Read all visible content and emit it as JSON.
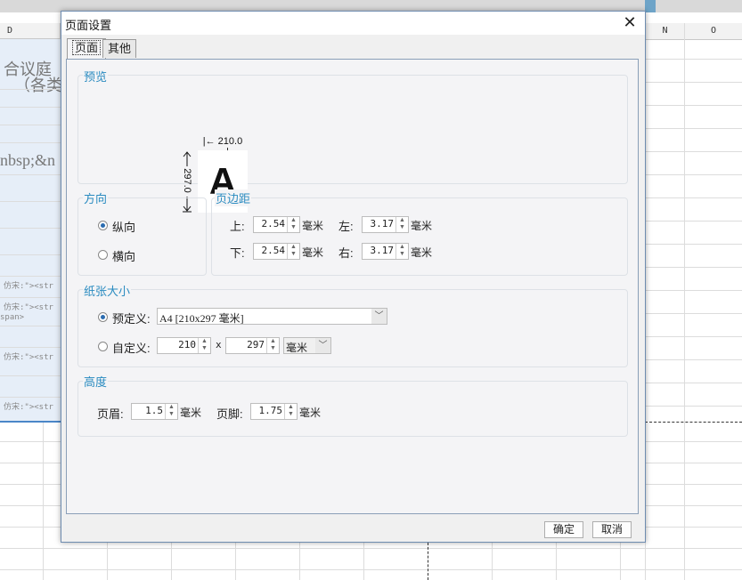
{
  "sheet": {
    "columns": [
      "D",
      "N",
      "O"
    ],
    "cell_texts": [
      "合议庭",
      "（各类",
      "nbsp;&n",
      "仿宋:\"><str",
      "仿宋:\"><str",
      "span>",
      "仿宋:\"><str",
      "仿宋:\"><str"
    ]
  },
  "dialog": {
    "title": "页面设置",
    "tabs": [
      "页面",
      "其他"
    ],
    "preview": {
      "legend": "预览",
      "width_label": "|← 210.0 →|",
      "height_label": "297.0",
      "sample_letter": "A"
    },
    "orientation": {
      "legend": "方向",
      "portrait": "纵向",
      "landscape": "横向",
      "selected": "portrait"
    },
    "margins": {
      "legend": "页边距",
      "top_label": "上:",
      "top_value": "2.54",
      "left_label": "左:",
      "left_value": "3.17",
      "bottom_label": "下:",
      "bottom_value": "2.54",
      "right_label": "右:",
      "right_value": "3.17",
      "unit": "毫米"
    },
    "paper_size": {
      "legend": "纸张大小",
      "predefined_label": "预定义:",
      "predefined_value": "A4 [210x297 毫米]",
      "custom_label": "自定义:",
      "custom_width": "210",
      "custom_times": "x",
      "custom_height": "297",
      "custom_unit": "毫米",
      "selected": "predefined"
    },
    "height": {
      "legend": "高度",
      "header_label": "页眉:",
      "header_value": "1.5",
      "footer_label": "页脚:",
      "footer_value": "1.75",
      "unit": "毫米"
    },
    "buttons": {
      "ok": "确定",
      "cancel": "取消"
    },
    "close_glyph": "✕"
  }
}
